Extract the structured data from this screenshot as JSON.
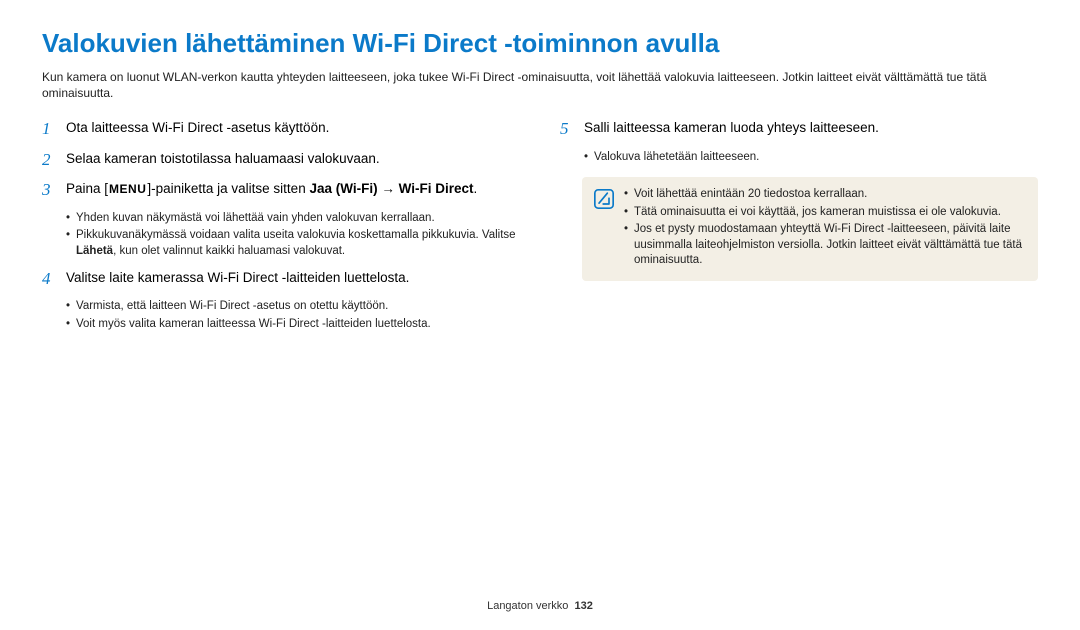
{
  "title": "Valokuvien lähettäminen Wi-Fi Direct -toiminnon avulla",
  "intro": "Kun kamera on luonut WLAN-verkon kautta yhteyden laitteeseen, joka tukee Wi-Fi Direct -ominaisuutta, voit lähettää valokuvia laitteeseen. Jotkin laitteet eivät välttämättä tue tätä ominaisuutta.",
  "left": {
    "step1": {
      "num": "1",
      "text": "Ota laitteessa Wi-Fi Direct -asetus käyttöön."
    },
    "step2": {
      "num": "2",
      "text": "Selaa kameran toistotilassa haluamaasi valokuvaan."
    },
    "step3": {
      "num": "3",
      "textPrefix": "Paina [",
      "menuLabel": "MENU",
      "textMid": "]-painiketta ja valitse sitten ",
      "bold1": "Jaa (Wi-Fi)",
      "arrow": " → ",
      "bold2": "Wi-Fi Direct",
      "textEnd": ".",
      "sub1": "Yhden kuvan näkymästä voi lähettää vain yhden valokuvan kerrallaan.",
      "sub2a": "Pikkukuvanäkymässä voidaan valita useita valokuvia koskettamalla pikkukuvia. Valitse ",
      "sub2b": "Lähetä",
      "sub2c": ", kun olet valinnut kaikki haluamasi valokuvat."
    },
    "step4": {
      "num": "4",
      "text": "Valitse laite kamerassa Wi-Fi Direct -laitteiden luettelosta.",
      "sub1": "Varmista, että laitteen Wi-Fi Direct -asetus on otettu käyttöön.",
      "sub2": "Voit myös valita kameran laitteessa Wi-Fi Direct -laitteiden luettelosta."
    }
  },
  "right": {
    "step5": {
      "num": "5",
      "text": "Salli laitteessa kameran luoda yhteys laitteeseen.",
      "sub1": "Valokuva lähetetään laitteeseen."
    },
    "note": {
      "item1": "Voit lähettää enintään 20 tiedostoa kerrallaan.",
      "item2": "Tätä ominaisuutta ei voi käyttää, jos kameran muistissa ei ole valokuvia.",
      "item3": "Jos et pysty muodostamaan yhteyttä Wi-Fi Direct -laitteeseen, päivitä laite uusimmalla laiteohjelmiston versiolla. Jotkin laitteet eivät välttämättä tue tätä ominaisuutta."
    }
  },
  "footer": {
    "label": "Langaton verkko",
    "page": "132"
  }
}
